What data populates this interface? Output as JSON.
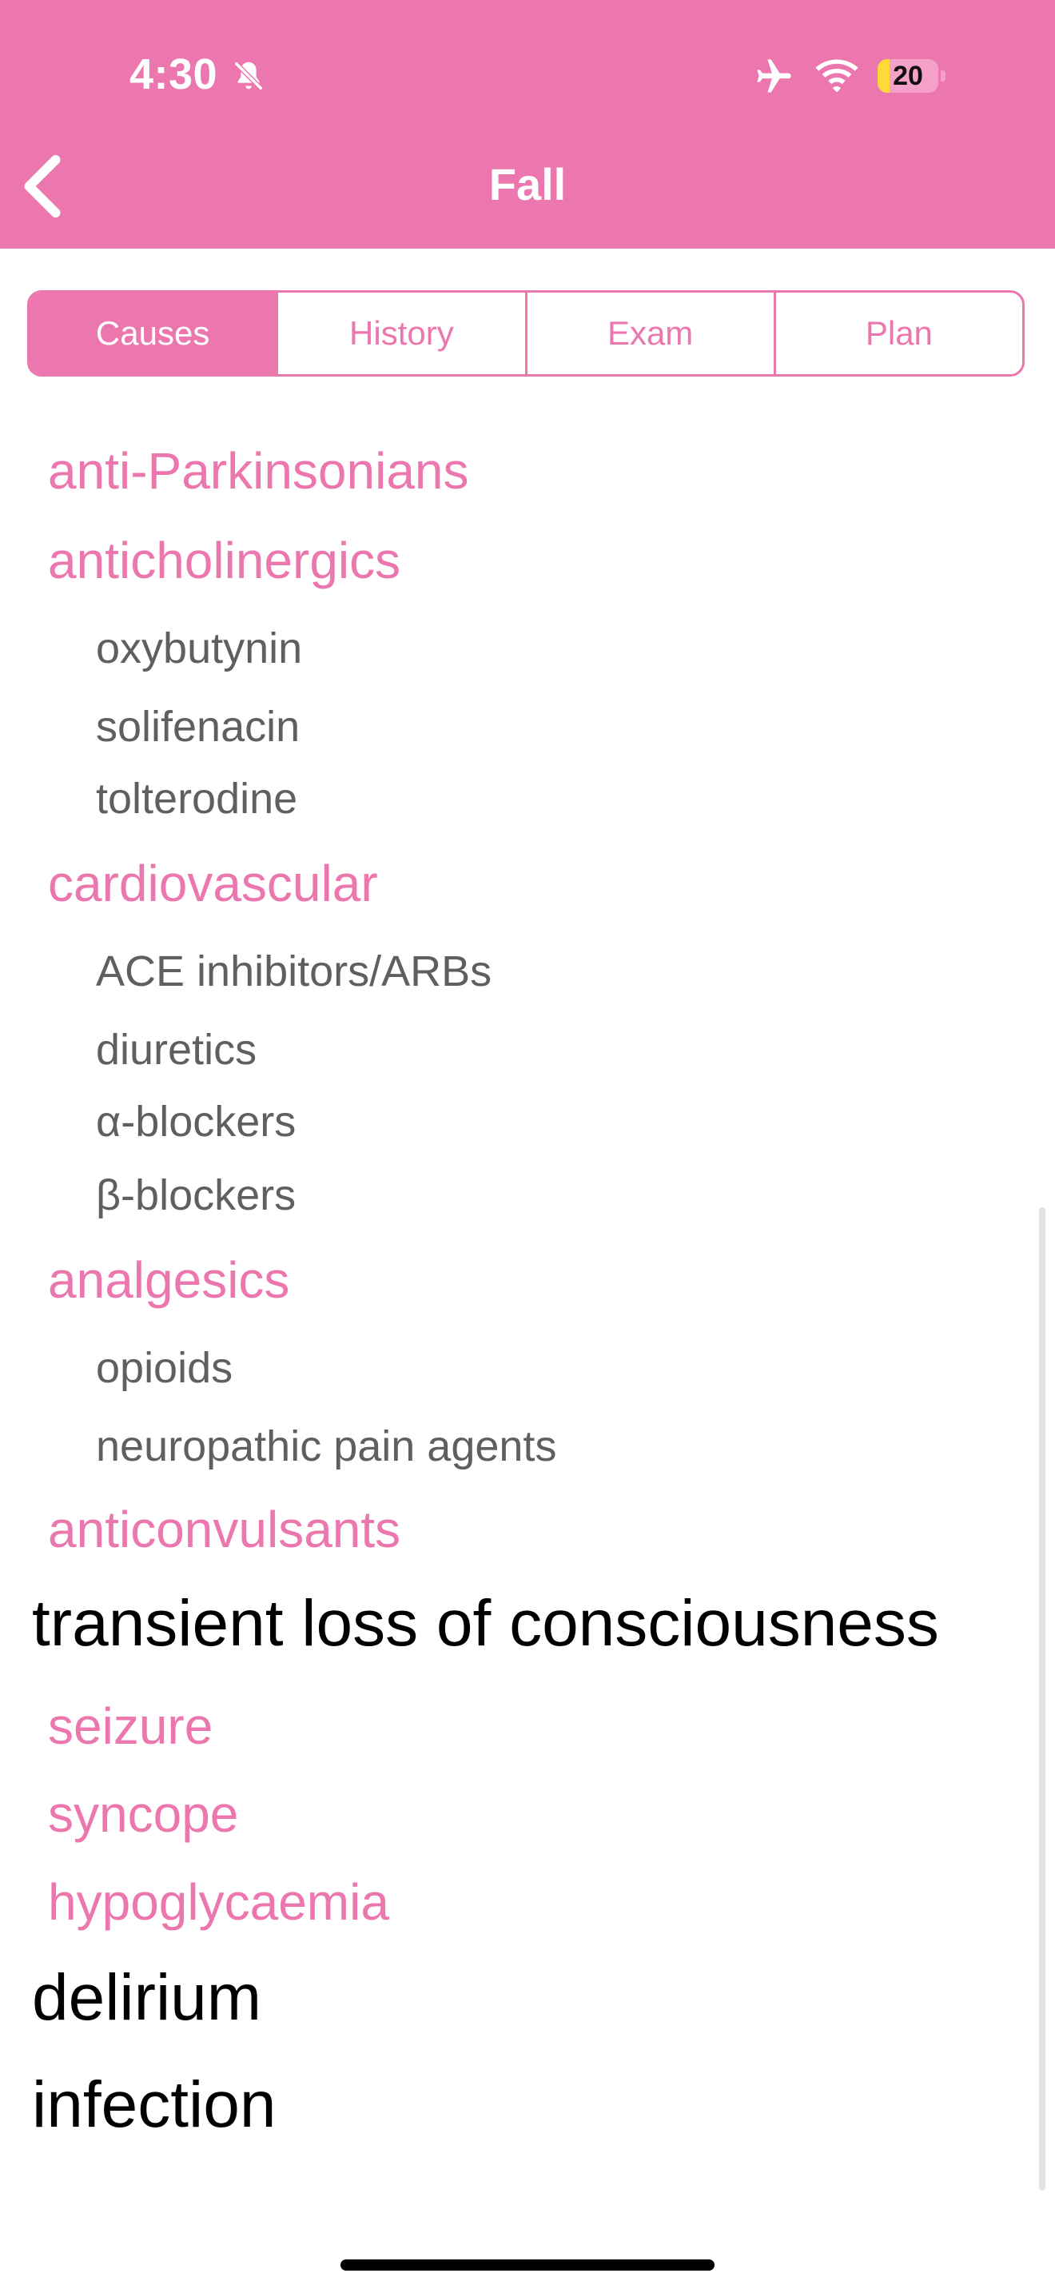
{
  "status_bar": {
    "time": "4:30",
    "battery_level": "20",
    "battery_fraction": 0.2
  },
  "nav": {
    "title": "Fall",
    "back_icon": "chevron-left-icon"
  },
  "tabs": [
    {
      "label": "Causes",
      "active": true
    },
    {
      "label": "History",
      "active": false
    },
    {
      "label": "Exam",
      "active": false
    },
    {
      "label": "Plan",
      "active": false
    }
  ],
  "list": [
    {
      "kind": "category",
      "text": "anti-Parkinsonians"
    },
    {
      "kind": "category",
      "text": "anticholinergics"
    },
    {
      "kind": "item",
      "text": "oxybutynin"
    },
    {
      "kind": "item",
      "text": "solifenacin"
    },
    {
      "kind": "item",
      "text": "tolterodine"
    },
    {
      "kind": "category",
      "text": "cardiovascular"
    },
    {
      "kind": "item",
      "text": "ACE inhibitors/ARBs"
    },
    {
      "kind": "item",
      "text": "diuretics"
    },
    {
      "kind": "item",
      "text": "α-blockers"
    },
    {
      "kind": "item",
      "text": "β-blockers"
    },
    {
      "kind": "category",
      "text": "analgesics"
    },
    {
      "kind": "item",
      "text": "opioids"
    },
    {
      "kind": "item",
      "text": "neuropathic pain agents"
    },
    {
      "kind": "category",
      "text": "anticonvulsants"
    },
    {
      "kind": "heading",
      "text": "transient loss of consciousness"
    },
    {
      "kind": "category",
      "text": "seizure"
    },
    {
      "kind": "category",
      "text": "syncope"
    },
    {
      "kind": "category",
      "text": "hypoglycaemia"
    },
    {
      "kind": "heading",
      "text": "delirium"
    },
    {
      "kind": "heading",
      "text": "infection"
    }
  ],
  "colors": {
    "accent": "#ec76ae",
    "subitem": "#5f5f5f",
    "heading": "#000000"
  }
}
